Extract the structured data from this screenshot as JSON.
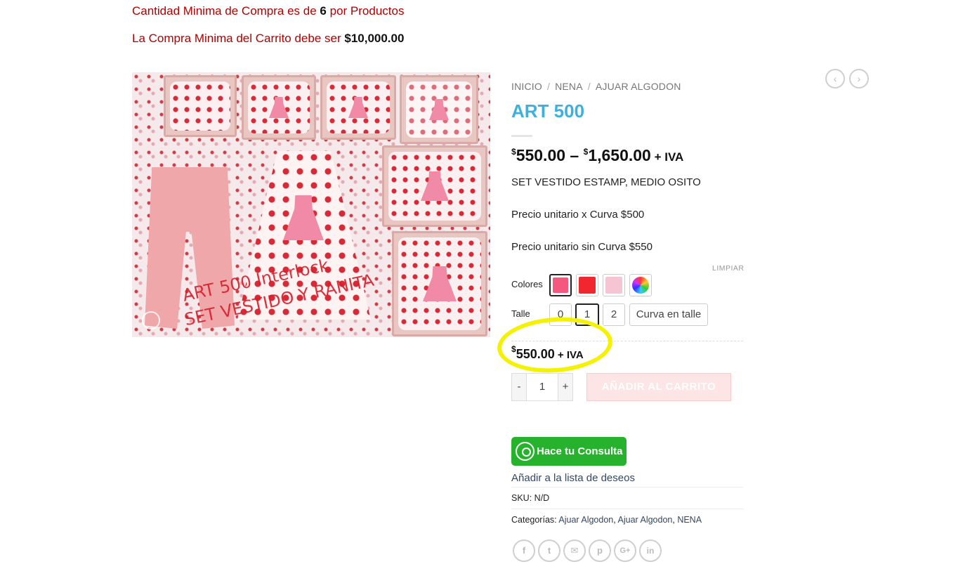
{
  "notices": {
    "min_qty_prefix": "Cantidad Minima de Compra es de ",
    "min_qty_value": "6",
    "min_qty_suffix": " por Productos",
    "min_cart_prefix": "La Compra Minima del Carrito debe ser ",
    "min_cart_value": "$10,000.00"
  },
  "image": {
    "overlay_line1": "ART  500    Interlock",
    "overlay_line2": "SET  VESTIDO Y RANITA"
  },
  "breadcrumb": [
    "INICIO",
    "NENA",
    "AJUAR ALGODON"
  ],
  "breadcrumb_separator": "/",
  "nav": {
    "prev_icon": "‹",
    "next_icon": "›"
  },
  "product": {
    "title": "ART 500",
    "price_currency": "$",
    "price_min": "550.00",
    "price_dash": " – ",
    "price_max": "1,650.00",
    "price_tax": " + IVA",
    "description": [
      "SET VESTIDO ESTAMP, MEDIO OSITO",
      "Precio unitario x Curva $500",
      "Precio unitario sin Curva $550"
    ]
  },
  "variations": {
    "clear_label": "LIMPIAR",
    "colores_label": "Colores",
    "talle_label": "Talle",
    "colors": [
      {
        "name": "rosa fuerte",
        "hex": "#f5577f",
        "selected": true
      },
      {
        "name": "rojo",
        "hex": "#f2262f",
        "selected": false
      },
      {
        "name": "rosa claro",
        "hex": "#f7c4d4",
        "selected": false
      },
      {
        "name": "multicolor",
        "hex": "multicolor",
        "selected": false
      }
    ],
    "sizes": [
      {
        "label": "0",
        "selected": false
      },
      {
        "label": "1",
        "selected": true
      },
      {
        "label": "2",
        "selected": false
      },
      {
        "label": "Curva en talle",
        "selected": false
      }
    ]
  },
  "selected_price": {
    "currency": "$",
    "amount": "550.00",
    "tax": " + IVA"
  },
  "cart": {
    "minus": "-",
    "quantity": "1",
    "plus": "+",
    "add_label": "AÑADIR AL CARRITO"
  },
  "whatsapp": {
    "label": "Hace tu Consulta"
  },
  "wishlist": {
    "label": "Añadir a la lista de deseos"
  },
  "meta": {
    "sku_label": "SKU:",
    "sku_value": " N/D",
    "categories_label": "Categorías: ",
    "categories": [
      "Ajuar Algodon",
      "Ajuar Algodon",
      "NENA"
    ]
  },
  "share": [
    "f",
    "t",
    "✉",
    "p",
    "G+",
    "in"
  ],
  "colors": {
    "notice_red": "#b20000",
    "title_blue": "#3cb0df",
    "whatsapp_green": "#26b22c",
    "highlight_yellow": "#f5f200",
    "link_blue": "#334862"
  }
}
